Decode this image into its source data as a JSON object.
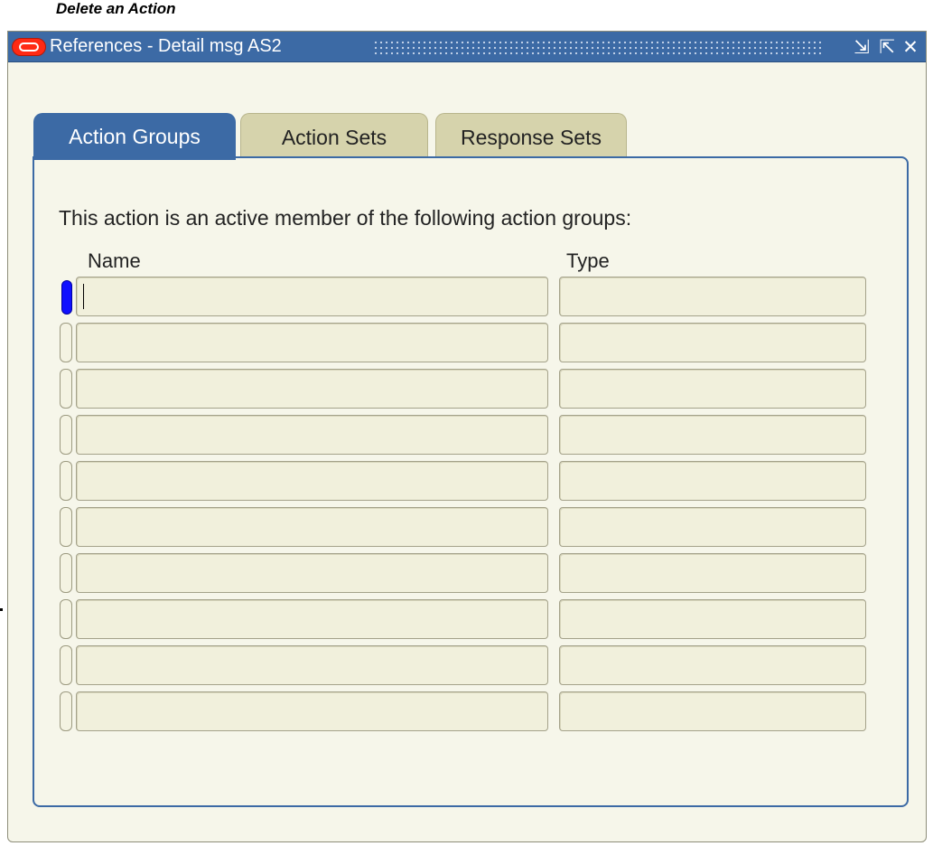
{
  "caption": "Delete an Action",
  "window": {
    "title": "References - Detail msg AS2",
    "buttons": {
      "minimize": "⇲",
      "maximize": "⇱",
      "close": "✕"
    }
  },
  "tabs": [
    {
      "label": "Action Groups",
      "active": true
    },
    {
      "label": "Action Sets",
      "active": false
    },
    {
      "label": "Response Sets",
      "active": false
    }
  ],
  "panel": {
    "prompt": "This action is an active member of the following action groups:",
    "columns": {
      "name": "Name",
      "type": "Type"
    },
    "rows": [
      {
        "name": "",
        "type": ""
      },
      {
        "name": "",
        "type": ""
      },
      {
        "name": "",
        "type": ""
      },
      {
        "name": "",
        "type": ""
      },
      {
        "name": "",
        "type": ""
      },
      {
        "name": "",
        "type": ""
      },
      {
        "name": "",
        "type": ""
      },
      {
        "name": "",
        "type": ""
      },
      {
        "name": "",
        "type": ""
      },
      {
        "name": "",
        "type": ""
      }
    ],
    "current_row": 1
  },
  "colors": {
    "accent": "#3c6aa5",
    "background": "#f6f6ea",
    "record_indicator": "#1010ff"
  }
}
